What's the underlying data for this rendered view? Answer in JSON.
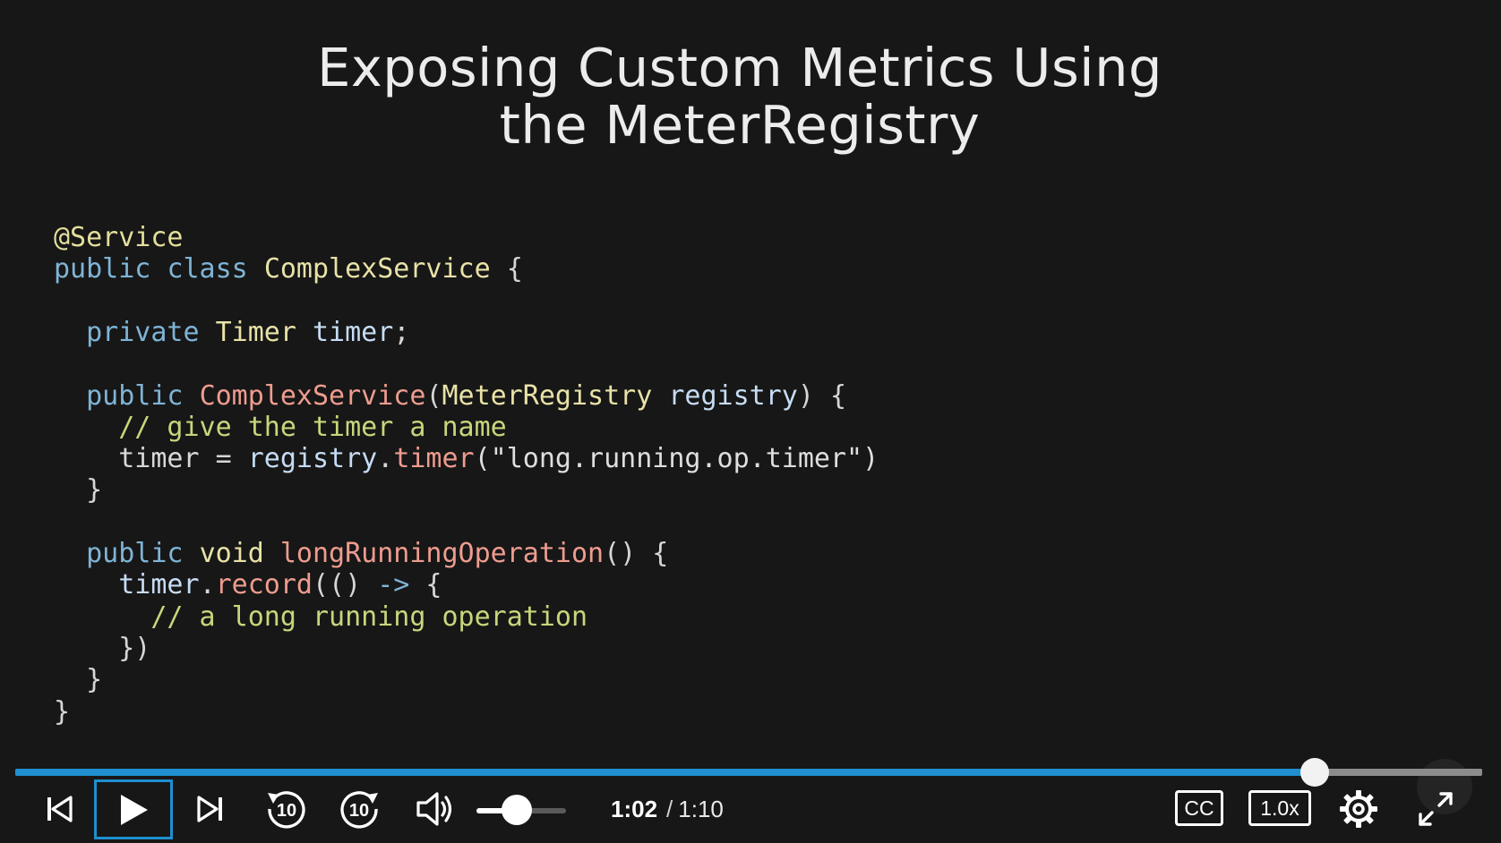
{
  "slide": {
    "title_line1": "Exposing Custom Metrics Using",
    "title_line2": "the MeterRegistry"
  },
  "code_lines": [
    [
      {
        "t": "@Service",
        "c": "ann"
      }
    ],
    [
      {
        "t": "public",
        "c": "kw"
      },
      {
        "t": " ",
        "c": "plain"
      },
      {
        "t": "class",
        "c": "kw"
      },
      {
        "t": " ",
        "c": "plain"
      },
      {
        "t": "ComplexService",
        "c": "ty"
      },
      {
        "t": " {",
        "c": "pun"
      }
    ],
    [],
    [
      {
        "t": "  ",
        "c": "plain"
      },
      {
        "t": "private",
        "c": "kw"
      },
      {
        "t": " ",
        "c": "plain"
      },
      {
        "t": "Timer",
        "c": "ty"
      },
      {
        "t": " ",
        "c": "plain"
      },
      {
        "t": "timer",
        "c": "var"
      },
      {
        "t": ";",
        "c": "pun"
      }
    ],
    [],
    [
      {
        "t": "  ",
        "c": "plain"
      },
      {
        "t": "public",
        "c": "kw"
      },
      {
        "t": " ",
        "c": "plain"
      },
      {
        "t": "ComplexService",
        "c": "fn"
      },
      {
        "t": "(",
        "c": "pun"
      },
      {
        "t": "MeterRegistry",
        "c": "ty"
      },
      {
        "t": " ",
        "c": "plain"
      },
      {
        "t": "registry",
        "c": "var"
      },
      {
        "t": ") {",
        "c": "pun"
      }
    ],
    [
      {
        "t": "    ",
        "c": "plain"
      },
      {
        "t": "// give the timer a name",
        "c": "com"
      }
    ],
    [
      {
        "t": "    ",
        "c": "plain"
      },
      {
        "t": "timer",
        "c": "plain"
      },
      {
        "t": " = ",
        "c": "pun"
      },
      {
        "t": "registry",
        "c": "var"
      },
      {
        "t": ".",
        "c": "pun"
      },
      {
        "t": "timer",
        "c": "fn"
      },
      {
        "t": "(\"long.running.op.timer\")",
        "c": "str"
      }
    ],
    [
      {
        "t": "  }",
        "c": "pun"
      }
    ],
    [],
    [
      {
        "t": "  ",
        "c": "plain"
      },
      {
        "t": "public",
        "c": "kw"
      },
      {
        "t": " ",
        "c": "plain"
      },
      {
        "t": "void",
        "c": "ty"
      },
      {
        "t": " ",
        "c": "plain"
      },
      {
        "t": "longRunningOperation",
        "c": "fn"
      },
      {
        "t": "() {",
        "c": "pun"
      }
    ],
    [
      {
        "t": "    ",
        "c": "plain"
      },
      {
        "t": "timer",
        "c": "var"
      },
      {
        "t": ".",
        "c": "pun"
      },
      {
        "t": "record",
        "c": "fn"
      },
      {
        "t": "(() ",
        "c": "pun"
      },
      {
        "t": "->",
        "c": "kw"
      },
      {
        "t": " {",
        "c": "pun"
      }
    ],
    [
      {
        "t": "      ",
        "c": "plain"
      },
      {
        "t": "// a long running operation",
        "c": "com"
      }
    ],
    [
      {
        "t": "    })",
        "c": "pun"
      }
    ],
    [
      {
        "t": "  }",
        "c": "pun"
      }
    ],
    [
      {
        "t": "}",
        "c": "pun"
      }
    ]
  ],
  "player": {
    "progress_fraction": 0.886,
    "volume_fraction": 0.45,
    "time_current": "1:02",
    "time_separator": "/",
    "time_total": "1:10",
    "cc_label": "CC",
    "speed_label": "1.0x",
    "skip_back_seconds": "10",
    "skip_forward_seconds": "10",
    "accent_color": "#1f8fcf",
    "icons": [
      "skip-previous-icon",
      "play-icon",
      "skip-next-icon",
      "rewind-10-icon",
      "forward-10-icon",
      "volume-icon",
      "settings-gear-icon",
      "fullscreen-icon"
    ]
  }
}
